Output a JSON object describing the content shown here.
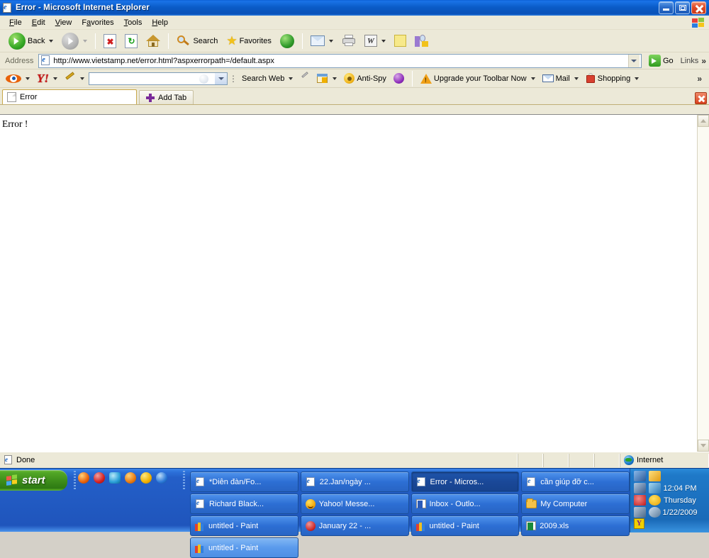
{
  "window": {
    "title": "Error - Microsoft Internet Explorer",
    "icon": "ie-document-icon",
    "controls": {
      "minimize": "Minimize",
      "maximize": "Restore",
      "close": "Close"
    }
  },
  "menu": {
    "items": [
      {
        "label": "File",
        "accel": "F"
      },
      {
        "label": "Edit",
        "accel": "E"
      },
      {
        "label": "View",
        "accel": "V"
      },
      {
        "label": "Favorites",
        "accel": "a"
      },
      {
        "label": "Tools",
        "accel": "T"
      },
      {
        "label": "Help",
        "accel": "H"
      }
    ],
    "brand_icon": "windows-flag-icon"
  },
  "toolbar": {
    "back_label": "Back",
    "back_icon": "back-arrow-icon",
    "forward_icon": "forward-arrow-icon",
    "stop_icon": "stop-icon",
    "refresh_icon": "refresh-icon",
    "home_icon": "home-icon",
    "search_label": "Search",
    "search_icon": "search-magnifier-icon",
    "favorites_label": "Favorites",
    "favorites_icon": "star-icon",
    "media_icon": "media-globe-icon",
    "mail_icon": "mail-icon",
    "print_icon": "printer-icon",
    "edit_word_icon": "word-edit-icon",
    "notes_icon": "yellow-note-icon",
    "research_icon": "research-icon"
  },
  "address": {
    "label": "Address",
    "url": "http://www.vietstamp.net/error.html?aspxerrorpath=/default.aspx",
    "favicon": "page-favicon",
    "go_label": "Go",
    "links_label": "Links",
    "overflow": "»"
  },
  "yahoo_toolbar": {
    "eye_icon": "yahoo-eye-icon",
    "logo": "Y!",
    "pencil_icon": "pencil-icon",
    "search_value": "",
    "search_placeholder": "",
    "search_web_label": "Search Web",
    "clip_icon": "paperclip-icon",
    "window_icon": "popup-blocker-icon",
    "antispy_label": "Anti-Spy",
    "antispy_icon": "antispy-icon",
    "purple_icon": "purple-circle-icon",
    "upgrade_label": "Upgrade your Toolbar Now",
    "upgrade_icon": "warning-triangle-icon",
    "mail_label": "Mail",
    "mail_icon": "envelope-icon",
    "shopping_label": "Shopping",
    "shopping_icon": "shopping-bag-icon",
    "overflow": "»"
  },
  "tabs": {
    "items": [
      {
        "label": "Error",
        "icon": "page-icon",
        "active": true
      }
    ],
    "add_tab_label": "Add Tab",
    "add_tab_icon": "plus-icon",
    "close_tab_icon": "close-tab-icon"
  },
  "page": {
    "text": "Error !"
  },
  "scrollbar": {
    "up_icon": "scroll-up-arrow",
    "down_icon": "scroll-down-arrow"
  },
  "statusbar": {
    "message": "Done",
    "message_icon": "page-icon",
    "zone_label": "Internet",
    "zone_icon": "globe-icon"
  },
  "taskbar": {
    "start_label": "start",
    "start_icon": "windows-logo-icon",
    "quicklaunch": [
      {
        "name": "firefox-icon",
        "color": "#e8620a"
      },
      {
        "name": "opera-icon",
        "color": "#d42020"
      },
      {
        "name": "ie-blue-icon",
        "color": "#2aa0d8"
      },
      {
        "name": "media-player-icon",
        "color": "#e87a10"
      },
      {
        "name": "yahoo-messenger-icon",
        "color": "#f0b000"
      },
      {
        "name": "internet-explorer-icon",
        "color": "#2a78d8"
      }
    ],
    "tasks": [
      {
        "label": "*Diễn đàn/Fo...",
        "icon": "ie",
        "state": "normal"
      },
      {
        "label": "22.Jan/ngày ...",
        "icon": "ie",
        "state": "normal"
      },
      {
        "label": "Error - Micros...",
        "icon": "ie",
        "state": "active"
      },
      {
        "label": "cần giúp đỡ c...",
        "icon": "ie",
        "state": "normal"
      },
      {
        "label": "Richard Black...",
        "icon": "ie",
        "state": "normal"
      },
      {
        "label": "Yahoo! Messe...",
        "icon": "smile",
        "state": "normal"
      },
      {
        "label": "Inbox - Outlo...",
        "icon": "outlook",
        "state": "normal"
      },
      {
        "label": "My Computer",
        "icon": "folder",
        "state": "normal"
      },
      {
        "label": "untitled - Paint",
        "icon": "paint",
        "state": "normal"
      },
      {
        "label": "January 22 - ...",
        "icon": "ym",
        "state": "normal"
      },
      {
        "label": "untitled - Paint",
        "icon": "paint",
        "state": "normal"
      },
      {
        "label": "2009.xls",
        "icon": "xls",
        "state": "normal"
      },
      {
        "label": "untitled - Paint",
        "icon": "paint",
        "state": "hover"
      }
    ],
    "tray": {
      "icons": [
        "network-icon",
        "mail-tray-icon",
        "display-icon",
        "messenger-tray-icon",
        "security-icon",
        "yahoo-smiley-icon",
        "volume-icon",
        "updates-icon"
      ],
      "yahoo_button": "Y"
    },
    "clock": {
      "time": "12:04 PM",
      "day": "Thursday",
      "date": "1/22/2009"
    }
  }
}
